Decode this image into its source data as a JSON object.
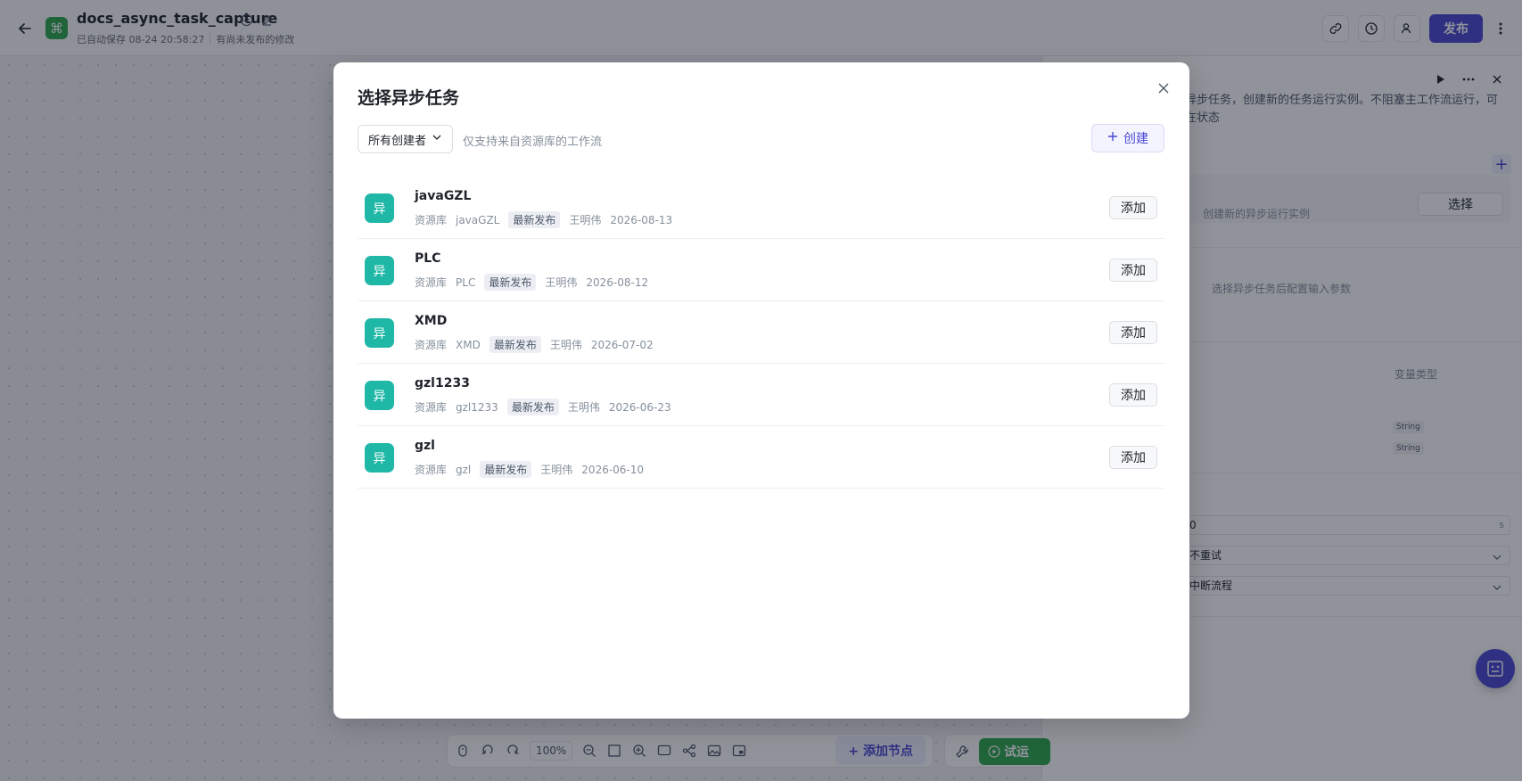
{
  "app": {
    "title": "docs_async_task_capture",
    "autosave": "已自动保存 08-24 20:58:27",
    "unpublished": "有尚未发布的修改",
    "publish_label": "发布",
    "logo_glyph": "⌘"
  },
  "side_panel": {
    "description": "异步任务，创建新的任务运行实例。不阻塞主工作流运行，可在状态",
    "card_text": "创建新的异步运行实例",
    "select_label": "选择",
    "hint": "选择异步任务后配置输入参数",
    "var_type_label": "变量类型",
    "var_types": [
      "String",
      "String"
    ],
    "timeout_value": "0",
    "timeout_suffix": "s",
    "retry_value": "不重试",
    "error_value": "中断流程"
  },
  "bottom_toolbar": {
    "zoom": "100%",
    "add_node_label": "添加节点",
    "trial_label": "试运"
  },
  "modal": {
    "title": "选择异步任务",
    "creator_filter": "所有创建者",
    "filter_hint": "仅支持来自资源库的工作流",
    "create_label": "创建",
    "add_label": "添加",
    "source_label": "资源库",
    "status_tag": "最新发布",
    "icon_glyph": "异",
    "tasks": [
      {
        "name": "javaGZL",
        "workflow": "javaGZL",
        "author": "王明伟",
        "date": "2026-08-13"
      },
      {
        "name": "PLC",
        "workflow": "PLC",
        "author": "王明伟",
        "date": "2026-08-12"
      },
      {
        "name": "XMD",
        "workflow": "XMD",
        "author": "王明伟",
        "date": "2026-07-02"
      },
      {
        "name": "gzl1233",
        "workflow": "gzl1233",
        "author": "王明伟",
        "date": "2026-06-23"
      },
      {
        "name": "gzl",
        "workflow": "gzl",
        "author": "王明伟",
        "date": "2026-06-10"
      }
    ]
  },
  "colors": {
    "accent": "#4b49d3",
    "task_icon": "#1fb8a6",
    "trial": "#2fa84f"
  }
}
